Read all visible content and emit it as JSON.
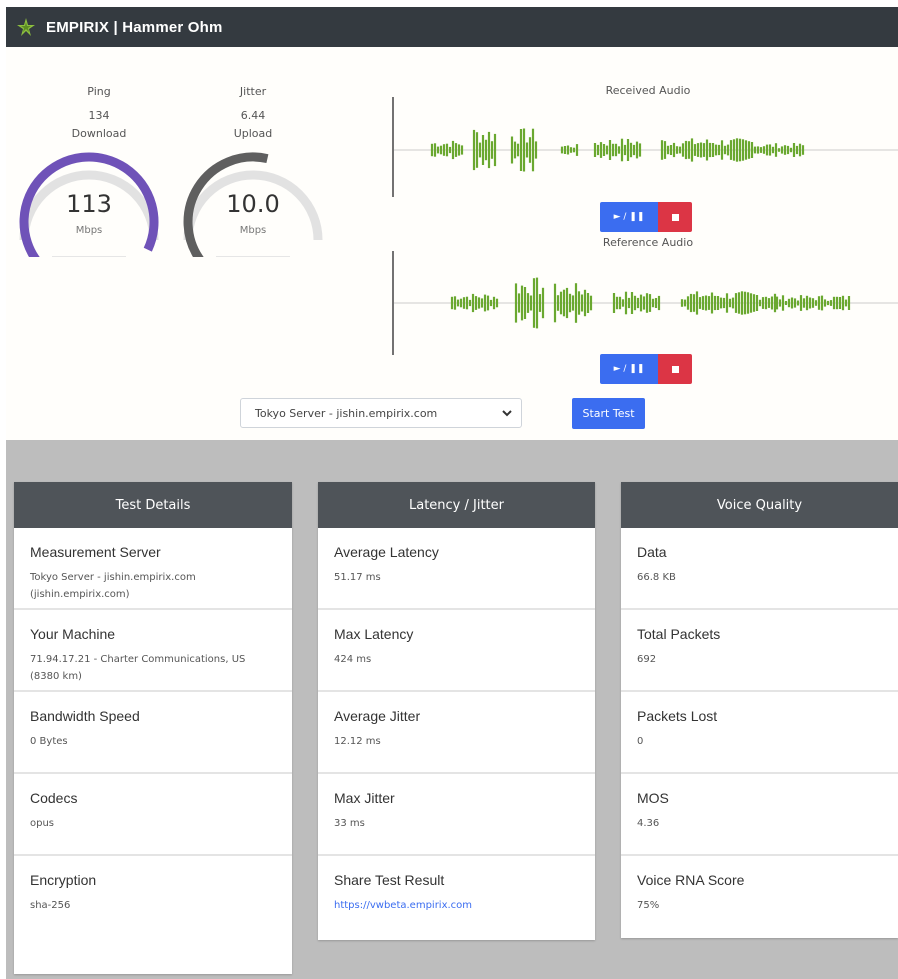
{
  "app": {
    "title": "EMPIRIX | Hammer Ohm",
    "icon": "empirix-logo-icon"
  },
  "gauges": {
    "ping": {
      "label": "Ping",
      "value": "134"
    },
    "jitter": {
      "label": "Jitter",
      "value": "6.44"
    },
    "download": {
      "label": "Download",
      "value": "113",
      "unit": "Mbps",
      "level": 0.95,
      "color": "#6f52b8"
    },
    "upload": {
      "label": "Upload",
      "value": "10.0",
      "unit": "Mbps",
      "level": 0.55,
      "color": "#5f5f5f"
    }
  },
  "audio": {
    "received_label": "Received Audio",
    "reference_label": "Reference Audio",
    "play_label": "► / ❚❚",
    "wave_color": "#6aa830"
  },
  "controls": {
    "server_select": "Tokyo Server - jishin.empirix.com",
    "start_button": "Start Test"
  },
  "cards": {
    "details": {
      "header": "Test Details",
      "items": [
        {
          "title": "Measurement Server",
          "value": "Tokyo Server - jishin.empirix.com (jishin.empirix.com)"
        },
        {
          "title": "Your Machine",
          "value": "71.94.17.21 - Charter Communications, US (8380 km)"
        },
        {
          "title": "Bandwidth Speed",
          "value": "0 Bytes"
        },
        {
          "title": "Codecs",
          "value": "opus"
        },
        {
          "title": "Encryption",
          "value": "sha-256"
        }
      ]
    },
    "latency": {
      "header": "Latency / Jitter",
      "items": [
        {
          "title": "Average Latency",
          "value": "51.17 ms"
        },
        {
          "title": "Max Latency",
          "value": "424 ms"
        },
        {
          "title": "Average Jitter",
          "value": "12.12 ms"
        },
        {
          "title": "Max Jitter",
          "value": "33 ms"
        },
        {
          "title": "Share Test Result",
          "value": "https://vwbeta.empirix.com"
        }
      ]
    },
    "voice": {
      "header": "Voice Quality",
      "items": [
        {
          "title": "Data",
          "value": "66.8 KB"
        },
        {
          "title": "Total Packets",
          "value": "692"
        },
        {
          "title": "Packets Lost",
          "value": "0"
        },
        {
          "title": "MOS",
          "value": "4.36"
        },
        {
          "title": "Voice RNA Score",
          "value": "75%"
        }
      ]
    }
  }
}
